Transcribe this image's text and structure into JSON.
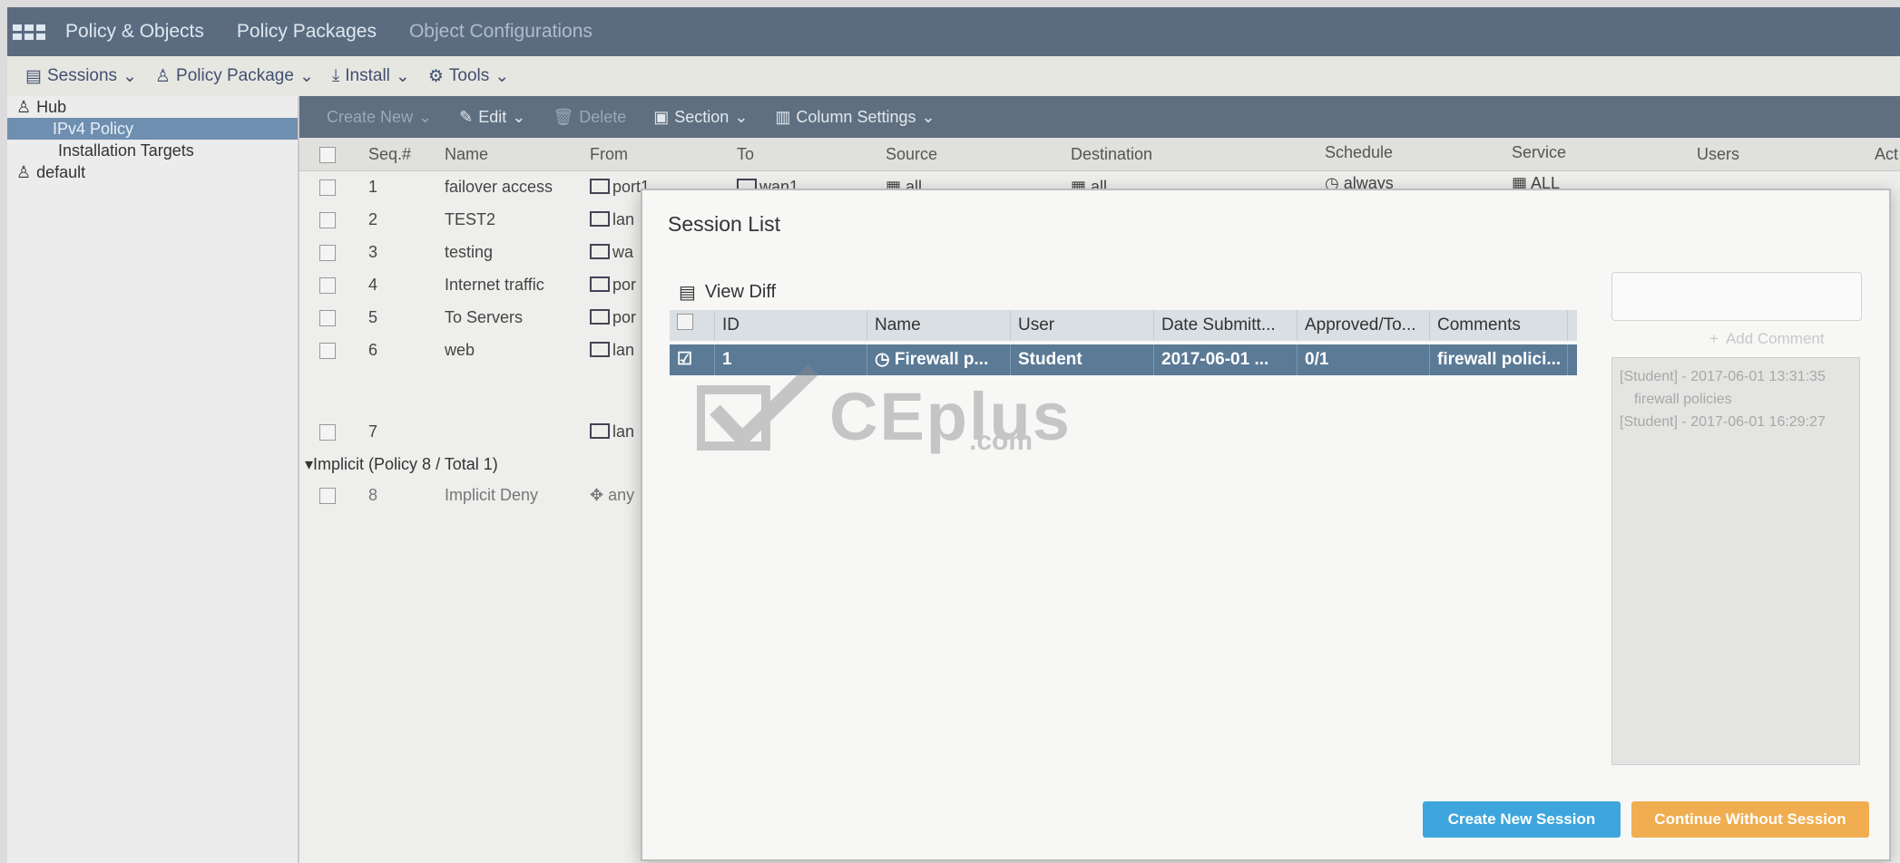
{
  "breadcrumb": [
    "Policy & Objects",
    "Policy Packages",
    "Object Configurations"
  ],
  "menubar": [
    "Sessions",
    "Policy Package",
    "Install",
    "Tools"
  ],
  "sidebar": {
    "items": [
      "Hub",
      "IPv4 Policy",
      "Installation Targets",
      "default"
    ]
  },
  "toolbar": [
    "Create New",
    "Edit",
    "Delete",
    "Section",
    "Column Settings"
  ],
  "grid": {
    "columns": [
      "Seq.#",
      "Name",
      "From",
      "To",
      "Source",
      "Destination",
      "Schedule",
      "Service",
      "Users",
      "Act"
    ],
    "rows": [
      {
        "seq": "1",
        "name": "failover access",
        "from": "port1",
        "to": "wan1",
        "source": "all",
        "dest": "all",
        "schedule": "always",
        "service": "ALL"
      },
      {
        "seq": "2",
        "name": "TEST2",
        "from": "lan"
      },
      {
        "seq": "3",
        "name": "testing",
        "from": "wa"
      },
      {
        "seq": "4",
        "name": "Internet traffic",
        "from": "por"
      },
      {
        "seq": "5",
        "name": "To Servers",
        "from": "por"
      },
      {
        "seq": "6",
        "name": "web",
        "from": "lan"
      },
      {
        "seq": "7",
        "name": "",
        "from": "lan"
      }
    ],
    "implicit_label": "Implicit (Policy 8 / Total 1)",
    "implicit_row": {
      "seq": "8",
      "name": "Implicit Deny",
      "from": "any"
    }
  },
  "modal": {
    "title": "Session List",
    "view_diff": "View Diff",
    "columns": [
      "ID",
      "Name",
      "User",
      "Date Submitt...",
      "Approved/To...",
      "Comments"
    ],
    "session": {
      "id": "1",
      "name": "Firewall p...",
      "user": "Student",
      "date": "2017-06-01 ...",
      "approved": "0/1",
      "comments": "firewall polici..."
    },
    "add_comment": "Add Comment",
    "comment_log": [
      "[Student] - 2017-06-01 13:31:35",
      "firewall policies",
      "[Student] - 2017-06-01 16:29:27"
    ],
    "create_button": "Create New Session",
    "continue_button": "Continue Without Session"
  },
  "watermark": {
    "main": "CEplus",
    "sub": ".com"
  }
}
